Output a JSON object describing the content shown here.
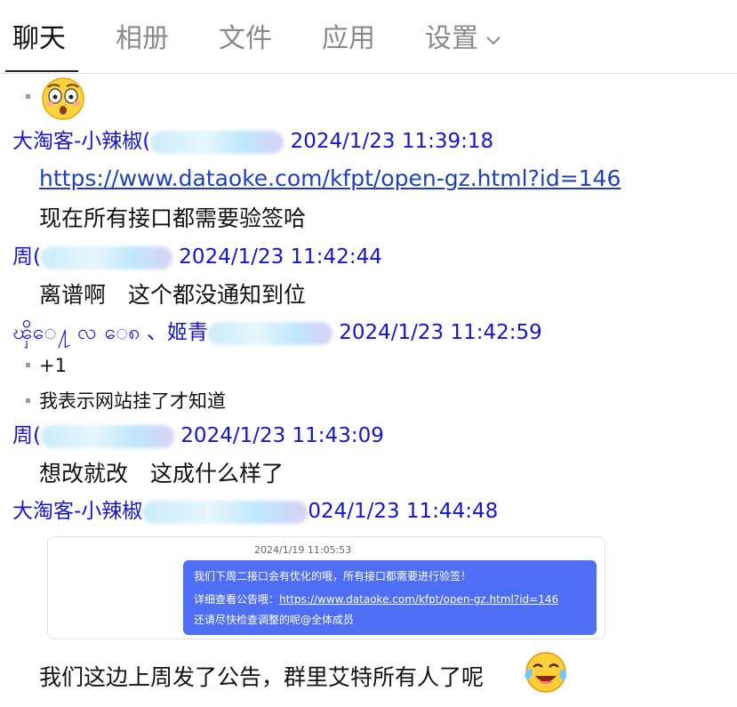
{
  "tabs": [
    {
      "label": "聊天"
    },
    {
      "label": "相册"
    },
    {
      "label": "文件"
    },
    {
      "label": "应用"
    },
    {
      "label": "设置"
    }
  ],
  "messages": {
    "m1": {
      "sender": "大淘客-小辣椒(",
      "time": "2024/1/23 11:39:18",
      "link": "https://www.dataoke.com/kfpt/open-gz.html?id=146",
      "text": "现在所有接口都需要验签哈"
    },
    "m2": {
      "sender": "周(",
      "time": "2024/1/23 11:42:44",
      "text": "离谱啊　这个都没通知到位"
    },
    "m3": {
      "sender": "ၾိေ႔ လ ေ၈ 、姬青",
      "time": "2024/1/23 11:42:59",
      "items": [
        "+1",
        "我表示网站挂了才知道"
      ]
    },
    "m4": {
      "sender": "周(",
      "time": "2024/1/23 11:43:09",
      "text": "想改就改　这成什么样了"
    },
    "m5": {
      "sender": "大淘客-小辣椒",
      "time": "024/1/23 11:44:48",
      "card": {
        "time": "2024/1/19 11:05:53",
        "line1": "我们下周二接口会有优化的哦，所有接口都需要进行验签！",
        "line2_prefix": "详细查看公告哦：",
        "line2_link": "https://www.dataoke.com/kfpt/open-gz.html?id=146",
        "line3": "还请尽快检查调整的呢@全体成员"
      },
      "text": "我们这边上周发了公告，群里艾特所有人了呢"
    }
  },
  "colors": {
    "sender": "#1414d4",
    "link": "#1f3fbf",
    "bubble": "#4e6ef5"
  },
  "icons": [
    "surprised-face-icon",
    "crying-laughing-face-icon",
    "chevron-down-icon"
  ]
}
